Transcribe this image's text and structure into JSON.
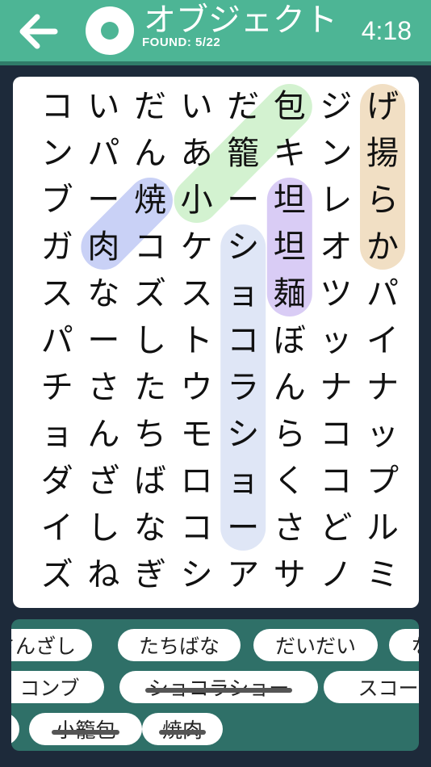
{
  "header": {
    "title": "オブジェクト",
    "found_label": "FOUND: 5/22",
    "timer": "4:18"
  },
  "board": {
    "grid": [
      [
        "コ",
        "い",
        "だ",
        "い",
        "だ",
        "包",
        "ジ",
        "げ"
      ],
      [
        "ン",
        "パ",
        "ん",
        "あ",
        "籠",
        "キ",
        "ン",
        "揚"
      ],
      [
        "ブ",
        "ー",
        "焼",
        "小",
        "ー",
        "坦",
        "レ",
        "ら"
      ],
      [
        "ガ",
        "肉",
        "コ",
        "ケ",
        "シ",
        "坦",
        "オ",
        "か"
      ],
      [
        "ス",
        "な",
        "ズ",
        "ス",
        "ョ",
        "麺",
        "ツ",
        "パ"
      ],
      [
        "パ",
        "ー",
        "し",
        "ト",
        "コ",
        "ぼ",
        "ッ",
        "イ"
      ],
      [
        "チ",
        "さ",
        "た",
        "ウ",
        "ラ",
        "ん",
        "ナ",
        "ナ"
      ],
      [
        "ョ",
        "ん",
        "ち",
        "モ",
        "シ",
        "ら",
        "コ",
        "ッ"
      ],
      [
        "ダ",
        "ざ",
        "ば",
        "ロ",
        "ョ",
        "く",
        "コ",
        "プ"
      ],
      [
        "イ",
        "し",
        "な",
        "コ",
        "ー",
        "さ",
        "ど",
        "ル"
      ],
      [
        "ズ",
        "ね",
        "ぎ",
        "シ",
        "ア",
        "サ",
        "ノ",
        "ミ"
      ]
    ],
    "highlights": [
      {
        "word": "から揚げ",
        "color": "#f1dfc4",
        "from": [
          0,
          7
        ],
        "to": [
          3,
          7
        ]
      },
      {
        "word": "小籠包",
        "color": "#d3f2d0",
        "from": [
          2,
          3
        ],
        "to": [
          0,
          5
        ]
      },
      {
        "word": "焼肉",
        "color": "#c9d1f6",
        "from": [
          2,
          2
        ],
        "to": [
          3,
          1
        ]
      },
      {
        "word": "坦坦麺",
        "color": "#d9ccf5",
        "from": [
          2,
          5
        ],
        "to": [
          4,
          5
        ]
      },
      {
        "word": "ショコラショー",
        "color": "#dfe6f6",
        "from": [
          3,
          4
        ],
        "to": [
          9,
          4
        ]
      }
    ]
  },
  "words": {
    "rows": [
      [
        {
          "label": "さんざし",
          "found": false
        },
        {
          "label": "たちばな",
          "found": false
        },
        {
          "label": "だいだい",
          "found": false
        },
        {
          "label": "な",
          "found": false
        }
      ],
      [
        {
          "label": "コンブ",
          "found": false
        },
        {
          "label": "ショコラショー",
          "found": true
        },
        {
          "label": "スコー",
          "found": false
        }
      ],
      [
        {
          "label": "",
          "found": false
        },
        {
          "label": "小籠包",
          "found": true
        },
        {
          "label": "焼肉",
          "found": true
        }
      ]
    ]
  },
  "colors": {
    "header": "#4db595",
    "tray": "#2f7068",
    "background": "#1d2a3a"
  }
}
